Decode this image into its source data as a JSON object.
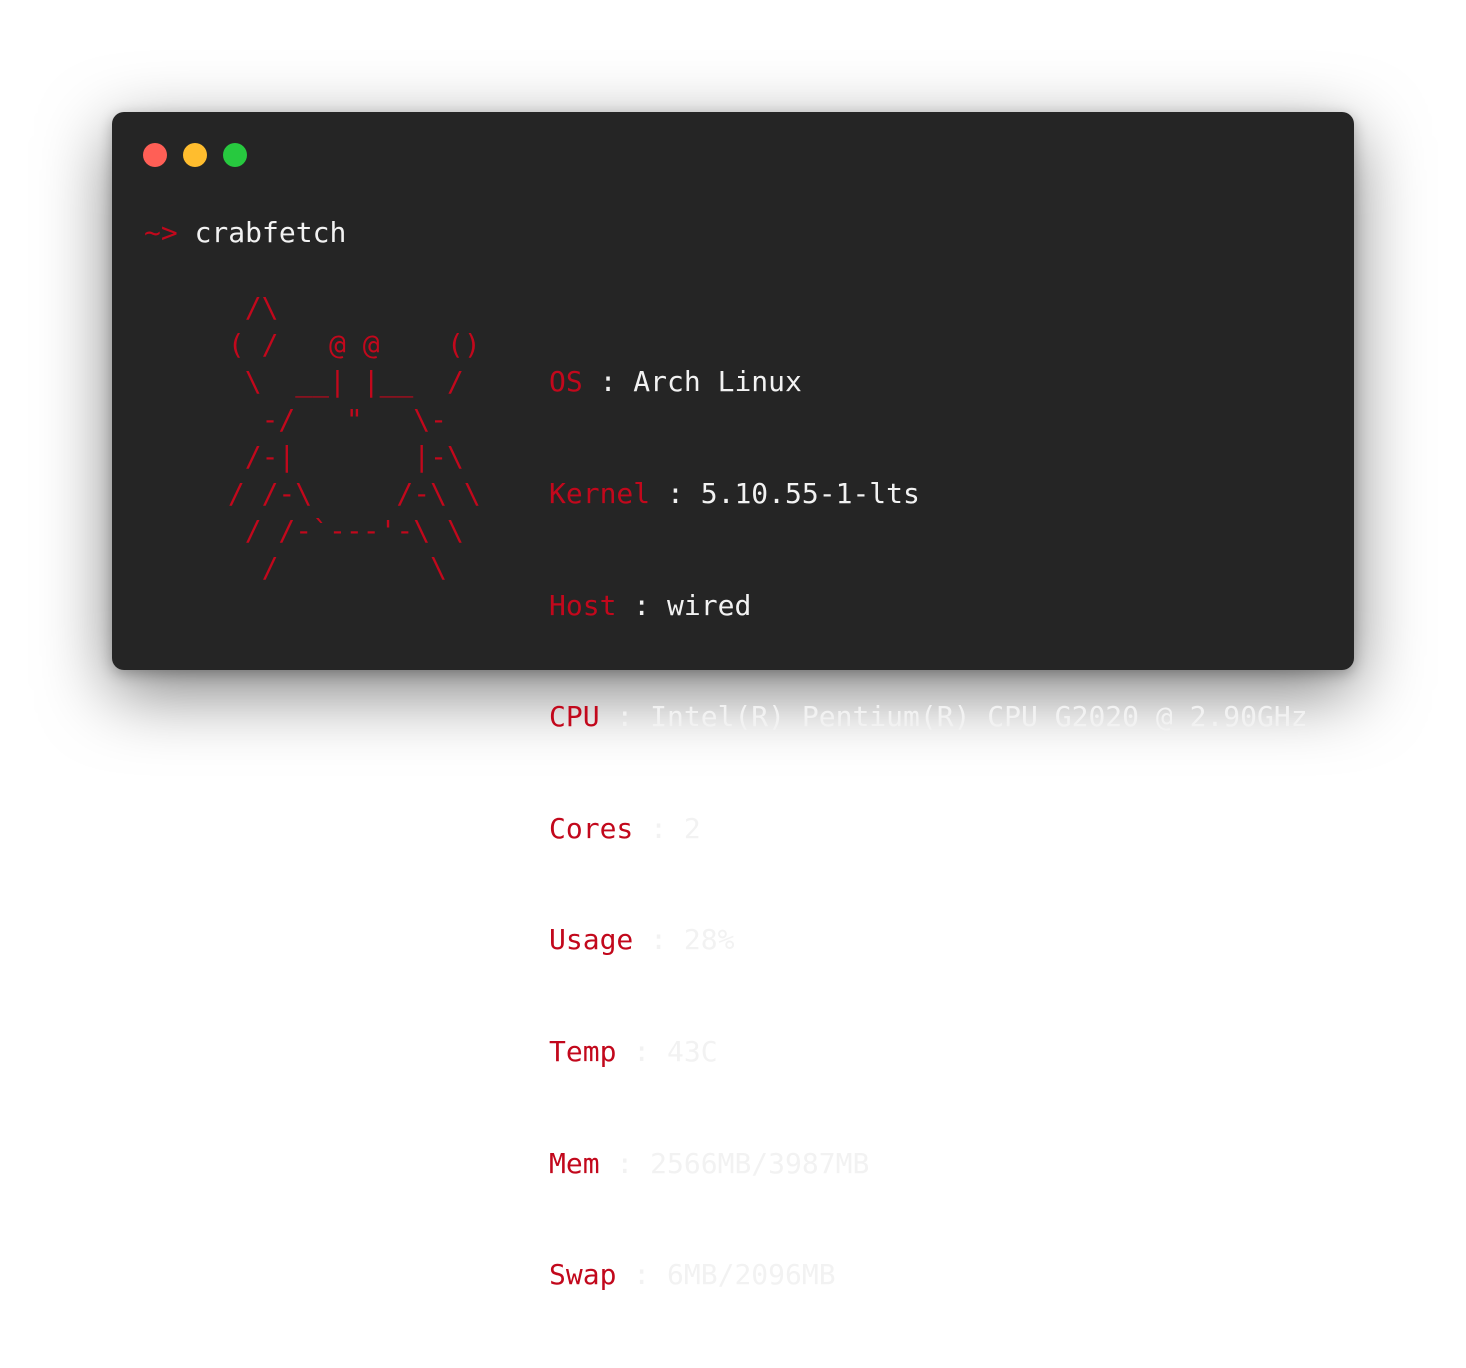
{
  "window": {
    "buttons": {
      "close": "close",
      "minimize": "minimize",
      "maximize": "maximize"
    }
  },
  "prompt": {
    "symbol": "~>",
    "command": "crabfetch"
  },
  "logo": [
    "  /\\",
    " ( /   @ @    ()",
    "  \\  __| |__  /",
    "   -/   \"   \\-",
    "  /-|       |-\\",
    " / /-\\     /-\\ \\",
    "  / /-`---'-\\ \\",
    "   /         \\"
  ],
  "info": [
    {
      "key": "OS",
      "value": "Arch Linux"
    },
    {
      "key": "Kernel",
      "value": "5.10.55-1-lts"
    },
    {
      "key": "Host",
      "value": "wired"
    },
    {
      "key": "CPU",
      "value": "Intel(R) Pentium(R) CPU G2020 @ 2.90GHz"
    },
    {
      "key": "Cores",
      "value": "2"
    },
    {
      "key": "Usage",
      "value": "28%"
    },
    {
      "key": "Temp",
      "value": "43C"
    },
    {
      "key": "Mem",
      "value": "2566MB/3987MB"
    },
    {
      "key": "Swap",
      "value": "6MB/2096MB"
    }
  ],
  "separator": " : ",
  "colors": {
    "accent": "#c2081c",
    "text": "#f2f2f2",
    "terminal_bg": "#252525",
    "close": "#ff5f56",
    "minimize": "#ffbd2e",
    "maximize": "#27c93f"
  }
}
